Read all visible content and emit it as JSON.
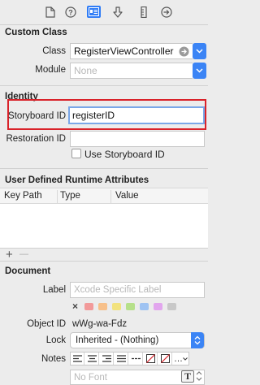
{
  "toolbar": {
    "tabs": [
      "file-icon",
      "help-icon",
      "identity-icon",
      "attributes-icon",
      "size-icon",
      "connections-icon"
    ],
    "active": "identity-icon"
  },
  "custom_class": {
    "title": "Custom Class",
    "class_label": "Class",
    "class_value": "RegisterViewController",
    "module_label": "Module",
    "module_placeholder": "None"
  },
  "identity": {
    "title": "Identity",
    "storyboard_id_label": "Storyboard ID",
    "storyboard_id_value": "registerID",
    "restoration_id_label": "Restoration ID",
    "restoration_id_value": "",
    "use_storyboard_id_label": "Use Storyboard ID",
    "use_storyboard_id_checked": false
  },
  "runtime_attributes": {
    "title": "User Defined Runtime Attributes",
    "columns": [
      "Key Path",
      "Type",
      "Value"
    ],
    "add_label": "+",
    "remove_label": "—"
  },
  "document": {
    "title": "Document",
    "label_label": "Label",
    "label_placeholder": "Xcode Specific Label",
    "swatch_clear": "×",
    "swatch_colors": [
      "#f29a9a",
      "#f7c08a",
      "#f2e27e",
      "#b6e08a",
      "#9fc3f2",
      "#e2a6ee",
      "#c8c8c8"
    ],
    "object_id_label": "Object ID",
    "object_id_value": "wWg-wa-Fdz",
    "lock_label": "Lock",
    "lock_value": "Inherited - (Nothing)",
    "notes_label": "Notes",
    "font_placeholder": "No Font",
    "more_label": "…"
  },
  "highlight_color": "#d9222a",
  "accent_color": "#3b84f5"
}
